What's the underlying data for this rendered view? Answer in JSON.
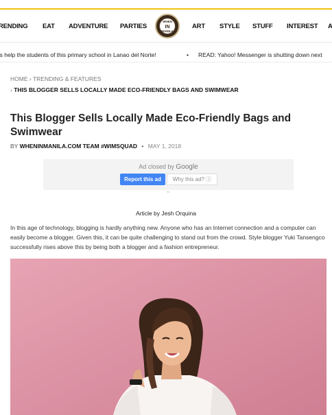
{
  "nav": {
    "items": [
      "RENDING",
      "EAT",
      "ADVENTURE",
      "PARTIES",
      "ART",
      "STYLE",
      "STUFF",
      "INTEREST",
      "A"
    ],
    "logo": [
      "WHEN",
      "IN",
      "MANILA"
    ]
  },
  "ticker": {
    "item1": "'s help the students of this primary school in Lanao del Norte!",
    "separator": "•",
    "item2": "READ: Yahoo! Messenger is shutting down next"
  },
  "breadcrumb": {
    "home": "HOME",
    "separator": "›",
    "category": "TRENDING & FEATURES",
    "current": "THIS BLOGGER SELLS LOCALLY MADE ECO-FRIENDLY BAGS AND SWIMWEAR"
  },
  "article": {
    "title": "This Blogger Sells Locally Made Eco-Friendly Bags and Swimwear",
    "by": "BY",
    "author": "WHENINMANILA.COM TEAM #WIMSQUAD",
    "dot": "•",
    "date": "MAY 1, 2018",
    "credit": "Article by Jesh Orquina",
    "paragraph": "In this age of technology, blogging is hardly anything new. Anyone who has an Internet connection and a computer can easily become a blogger. Given this, it can be quite challenging to stand out from the crowd. Style blogger Yuki Tansengco successfully rises above this by being both a blogger and a fashion entrepreneur."
  },
  "ad": {
    "closed_by": "Ad closed by",
    "google": "Google",
    "report": "Report this ad",
    "why": "Why this ad? ⓘ",
    "quote": "\""
  },
  "colors": {
    "accent": "#f1c40f",
    "ad_blue": "#4285f4",
    "photo_bg": "#d98c9e"
  }
}
